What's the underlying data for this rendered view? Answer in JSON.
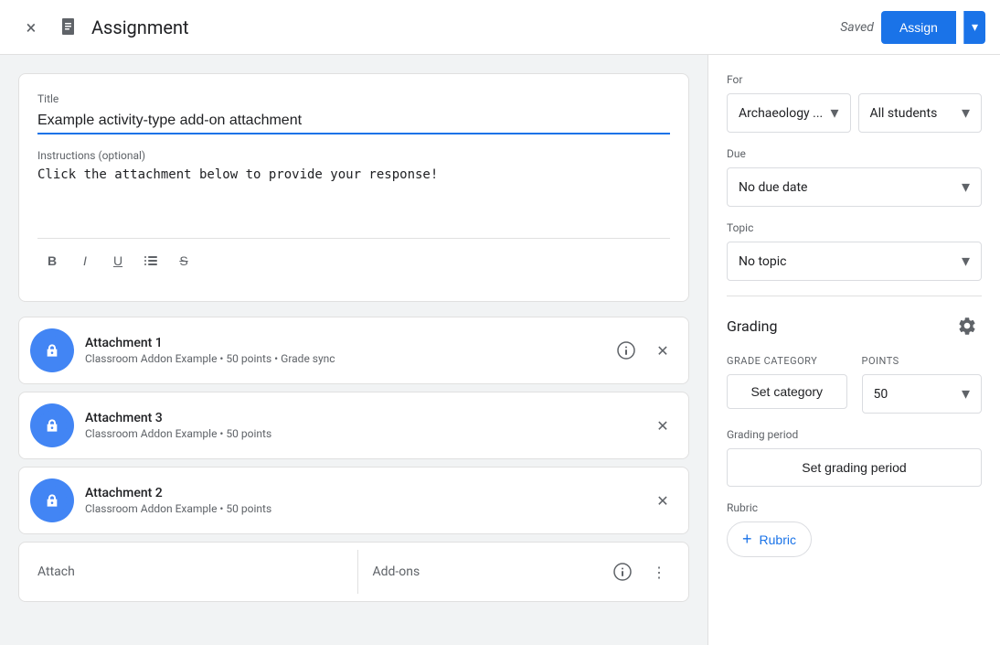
{
  "header": {
    "title": "Assignment",
    "saved_label": "Saved",
    "assign_label": "Assign",
    "close_icon": "×",
    "doc_icon": "📋",
    "dropdown_icon": "▾"
  },
  "editor": {
    "title_label": "Title",
    "title_value": "Example activity-type add-on attachment",
    "instructions_label": "Instructions (optional)",
    "instructions_value": "Click the attachment below to provide your response!",
    "toolbar": {
      "bold": "B",
      "italic": "I",
      "underline": "U",
      "list": "≡",
      "strikethrough": "S̶"
    }
  },
  "attachments": [
    {
      "name": "Attachment 1",
      "meta": "Classroom Addon Example • 50 points • Grade sync"
    },
    {
      "name": "Attachment 3",
      "meta": "Classroom Addon Example • 50 points"
    },
    {
      "name": "Attachment 2",
      "meta": "Classroom Addon Example • 50 points"
    }
  ],
  "bottom_bar": {
    "attach_label": "Attach",
    "addons_label": "Add-ons"
  },
  "sidebar": {
    "for_label": "For",
    "class_value": "Archaeology ...",
    "students_value": "All students",
    "due_label": "Due",
    "due_value": "No due date",
    "topic_label": "Topic",
    "topic_value": "No topic",
    "grading_label": "Grading",
    "grade_category_label": "Grade category",
    "points_label": "Points",
    "set_category_label": "Set category",
    "points_value": "50",
    "grading_period_label": "Grading period",
    "set_grading_period_label": "Set grading period",
    "rubric_label": "Rubric",
    "add_rubric_label": "+ Rubric"
  }
}
